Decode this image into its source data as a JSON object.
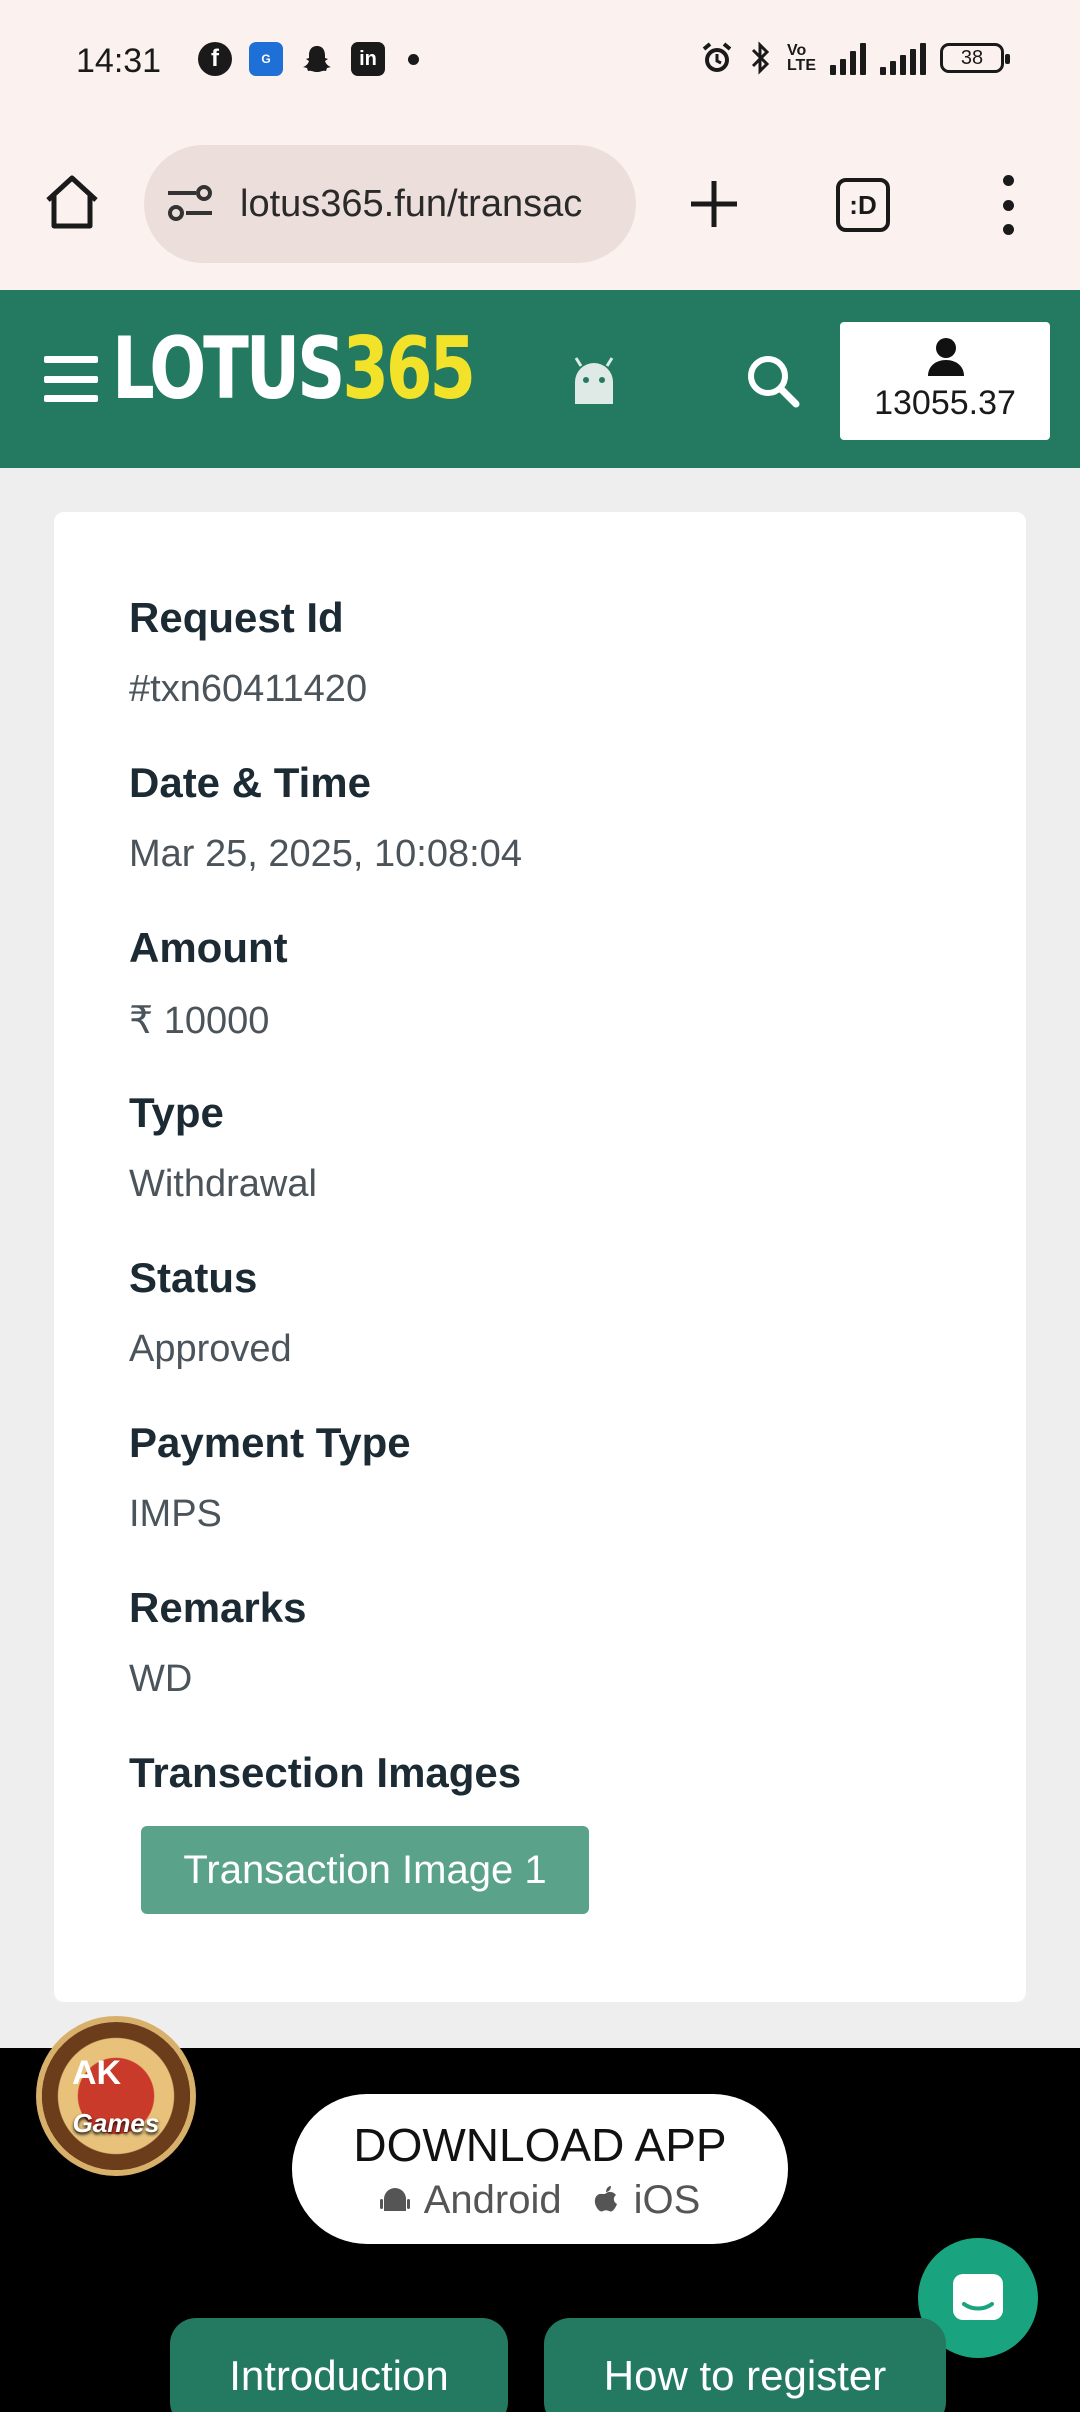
{
  "status_bar": {
    "time": "14:31",
    "left_icons": [
      "facebook-icon",
      "gboard-icon",
      "snapchat-icon",
      "linkedin-icon"
    ],
    "battery": "38",
    "network": "4G"
  },
  "browser": {
    "url": "lotus365.fun/transac",
    "tab_label": ":D"
  },
  "header": {
    "logo_white": "LOTUS",
    "logo_yellow": "365",
    "balance": "13055.37",
    "brand_color": "#237a61",
    "logo_accent": "#f2e22a"
  },
  "details": [
    {
      "label": "Request Id",
      "value": "#txn60411420"
    },
    {
      "label": "Date & Time",
      "value": "Mar 25, 2025, 10:08:04"
    },
    {
      "label": "Amount",
      "value": "₹ 10000"
    },
    {
      "label": "Type",
      "value": "Withdrawal"
    },
    {
      "label": "Status",
      "value": "Approved"
    },
    {
      "label": "Payment Type",
      "value": "IMPS"
    },
    {
      "label": "Remarks",
      "value": "WD"
    }
  ],
  "images_section": {
    "label": "Transection Images",
    "button": "Transaction Image 1"
  },
  "games_badge": {
    "label": "Games",
    "cards": "AK"
  },
  "download": {
    "title": "DOWNLOAD APP",
    "android": "Android",
    "ios": "iOS"
  },
  "footer_buttons": [
    "Introduction",
    "How to register"
  ]
}
